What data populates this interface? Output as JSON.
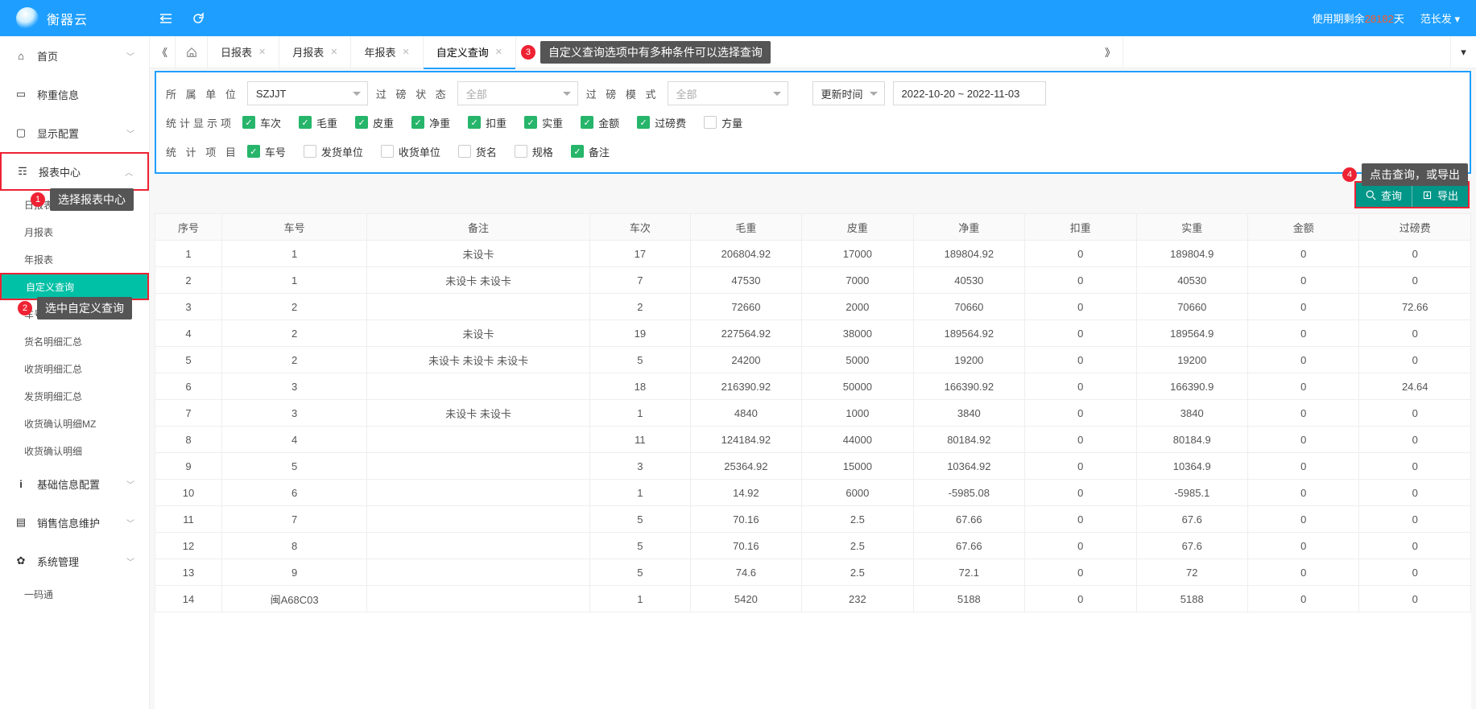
{
  "brand": "衡器云",
  "expire_prefix": "使用期剩余",
  "expire_days": "28182",
  "expire_suffix": "天",
  "username": "范长发",
  "sidebar": {
    "home": "首页",
    "weigh": "称重信息",
    "display": "显示配置",
    "report": "报表中心",
    "report_items": [
      "日报表",
      "月报表",
      "年报表",
      "自定义查询",
      "车号明细汇总",
      "货名明细汇总",
      "收货明细汇总",
      "发货明细汇总",
      "收货确认明细MZ",
      "收货确认明细"
    ],
    "base": "基础信息配置",
    "sales": "销售信息维护",
    "sys": "系统管理",
    "code": "一码通"
  },
  "tabs": [
    "日报表",
    "月报表",
    "年报表",
    "自定义查询"
  ],
  "filter": {
    "org_label": "所 属 单 位",
    "org_value": "SZJJT",
    "status_label": "过 磅 状 态",
    "status_value": "全部",
    "mode_label": "过 磅 模 式",
    "mode_value": "全部",
    "time_label": "更新时间",
    "date_range": "2022-10-20 ~ 2022-11-03",
    "row2_label": "统计显示项",
    "row3_label": "统 计 项 目",
    "opts2": [
      {
        "l": "车次",
        "on": true
      },
      {
        "l": "毛重",
        "on": true
      },
      {
        "l": "皮重",
        "on": true
      },
      {
        "l": "净重",
        "on": true
      },
      {
        "l": "扣重",
        "on": true
      },
      {
        "l": "实重",
        "on": true
      },
      {
        "l": "金额",
        "on": true
      },
      {
        "l": "过磅费",
        "on": true
      },
      {
        "l": "方量",
        "on": false
      }
    ],
    "opts3": [
      {
        "l": "车号",
        "on": true
      },
      {
        "l": "发货单位",
        "on": false
      },
      {
        "l": "收货单位",
        "on": false
      },
      {
        "l": "货名",
        "on": false
      },
      {
        "l": "规格",
        "on": false
      },
      {
        "l": "备注",
        "on": true
      }
    ]
  },
  "buttons": {
    "query": "查询",
    "export": "导出"
  },
  "tips": {
    "t1": "选择报表中心",
    "t2": "选中自定义查询",
    "t3": "自定义查询选项中有多种条件可以选择查询",
    "t4": "点击查询，或导出"
  },
  "table": {
    "headers": [
      "序号",
      "车号",
      "备注",
      "车次",
      "毛重",
      "皮重",
      "净重",
      "扣重",
      "实重",
      "金额",
      "过磅费"
    ],
    "rows": [
      [
        "1",
        "1",
        "未设卡",
        "17",
        "206804.92",
        "17000",
        "189804.92",
        "0",
        "189804.9",
        "0",
        "0"
      ],
      [
        "2",
        "1",
        "未设卡 未设卡",
        "7",
        "47530",
        "7000",
        "40530",
        "0",
        "40530",
        "0",
        "0"
      ],
      [
        "3",
        "2",
        "",
        "2",
        "72660",
        "2000",
        "70660",
        "0",
        "70660",
        "0",
        "72.66"
      ],
      [
        "4",
        "2",
        "未设卡",
        "19",
        "227564.92",
        "38000",
        "189564.92",
        "0",
        "189564.9",
        "0",
        "0"
      ],
      [
        "5",
        "2",
        "未设卡 未设卡 未设卡",
        "5",
        "24200",
        "5000",
        "19200",
        "0",
        "19200",
        "0",
        "0"
      ],
      [
        "6",
        "3",
        "",
        "18",
        "216390.92",
        "50000",
        "166390.92",
        "0",
        "166390.9",
        "0",
        "24.64"
      ],
      [
        "7",
        "3",
        "未设卡 未设卡",
        "1",
        "4840",
        "1000",
        "3840",
        "0",
        "3840",
        "0",
        "0"
      ],
      [
        "8",
        "4",
        "",
        "11",
        "124184.92",
        "44000",
        "80184.92",
        "0",
        "80184.9",
        "0",
        "0"
      ],
      [
        "9",
        "5",
        "",
        "3",
        "25364.92",
        "15000",
        "10364.92",
        "0",
        "10364.9",
        "0",
        "0"
      ],
      [
        "10",
        "6",
        "",
        "1",
        "14.92",
        "6000",
        "-5985.08",
        "0",
        "-5985.1",
        "0",
        "0"
      ],
      [
        "11",
        "7",
        "",
        "5",
        "70.16",
        "2.5",
        "67.66",
        "0",
        "67.6",
        "0",
        "0"
      ],
      [
        "12",
        "8",
        "",
        "5",
        "70.16",
        "2.5",
        "67.66",
        "0",
        "67.6",
        "0",
        "0"
      ],
      [
        "13",
        "9",
        "",
        "5",
        "74.6",
        "2.5",
        "72.1",
        "0",
        "72",
        "0",
        "0"
      ],
      [
        "14",
        "闽A68C03",
        "",
        "1",
        "5420",
        "232",
        "5188",
        "0",
        "5188",
        "0",
        "0"
      ]
    ]
  }
}
